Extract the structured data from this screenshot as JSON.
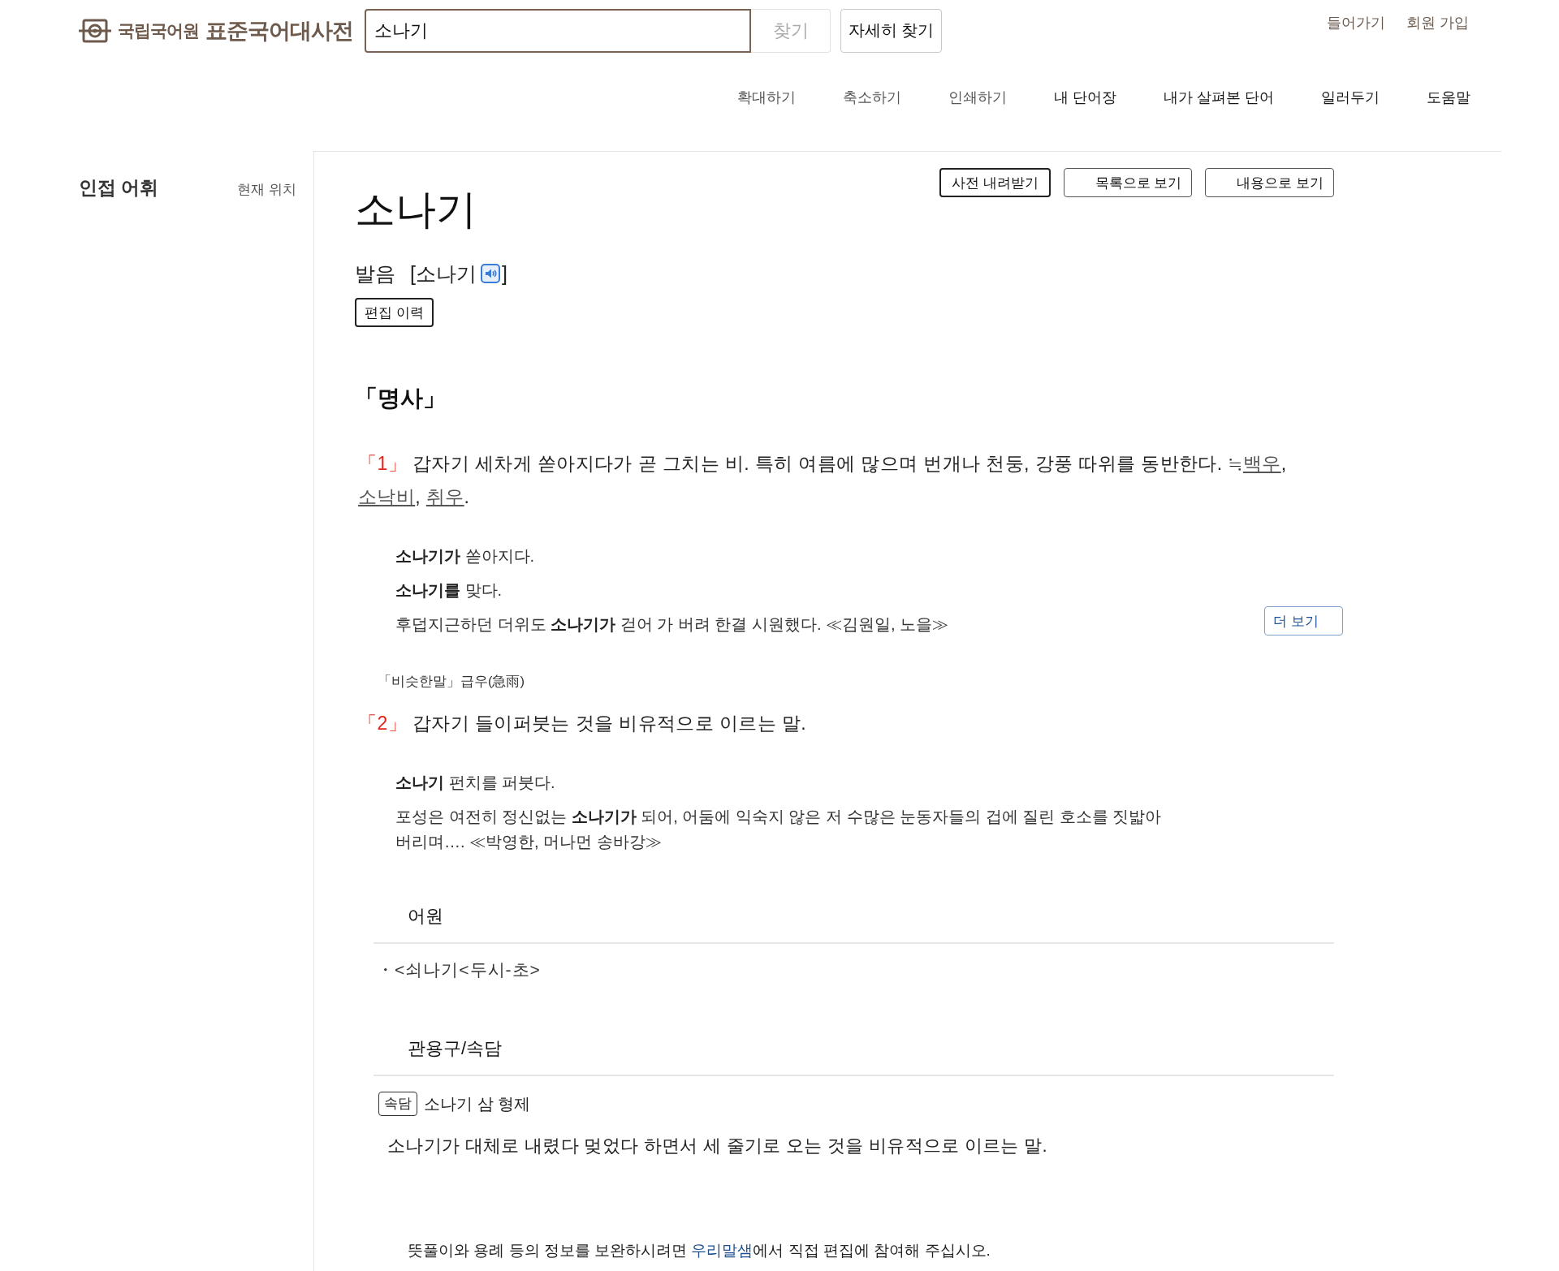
{
  "header": {
    "logo": {
      "organization": "국립국어원",
      "title": "표준국어대사전"
    },
    "search": {
      "value": "소나기",
      "button": "찾기"
    },
    "detail_search": "자세히 찾기",
    "account_links": [
      "들어가기",
      "회원 가입"
    ]
  },
  "toolbar": [
    {
      "label": "확대하기",
      "kind": "tool"
    },
    {
      "label": "축소하기",
      "kind": "tool"
    },
    {
      "label": "인쇄하기",
      "kind": "tool"
    },
    {
      "label": "내 단어장",
      "kind": "menu"
    },
    {
      "label": "내가 살펴본 단어",
      "kind": "menu"
    },
    {
      "label": "일러두기",
      "kind": "menu"
    },
    {
      "label": "도움말",
      "kind": "menu"
    }
  ],
  "sidebar": {
    "title": "인접 어휘",
    "current_position": "현재 위치"
  },
  "entry": {
    "actions": [
      {
        "label": "사전 내려받기",
        "kind": "plain"
      },
      {
        "label": "목록으로 보기",
        "kind": "view"
      },
      {
        "label": "내용으로 보기",
        "kind": "view"
      }
    ],
    "headword": "소나기",
    "pronunciation": {
      "label": "발음",
      "before_icon": "[소나기",
      "after_icon": "]"
    },
    "edit_history": "편집 이력",
    "part_of_speech": "「명사」",
    "senses": [
      {
        "number": "「1」",
        "definition": "갑자기 세차게 쏟아지다가 곧 그치는 비. 특히 여름에 많으며 번개나 천둥, 강풍 따위를 동반한다.",
        "related_mark": "≒",
        "related": [
          {
            "word": "백우",
            "after": ","
          },
          {
            "word": "소낙비",
            "after": ","
          },
          {
            "word": "취우",
            "after": "."
          }
        ],
        "examples": [
          "**소나기가** 쏟아지다.",
          "**소나기를** 맞다.",
          "후덥지근하던 더위도 **소나기가** 걷어 가 버려 한결 시원했다. ≪김원일, 노을≫"
        ],
        "more_button": "더 보기",
        "synonym": "「비슷한말」급우(急雨)"
      },
      {
        "number": "「2」",
        "definition": "갑자기 들이퍼붓는 것을 비유적으로 이르는 말.",
        "examples": [
          "**소나기** 펀치를 퍼붓다.",
          "포성은 여전히 정신없는 **소나기가** 되어, 어둠에 익숙지 않은 저 수많은 눈동자들의 겁에 질린 호소를 짓밟아 버리며…. ≪박영한, 머나먼 송바강≫"
        ]
      }
    ],
    "etymology": {
      "title": "어원",
      "items": [
        "・<쇠나기<두시-초>"
      ]
    },
    "idioms": {
      "title": "관용구/속담",
      "items": [
        {
          "tag": "속담",
          "phrase": "소나기 삼 형제",
          "meaning": "소나기가 대체로 내렸다 멎었다 하면서 세 줄기로 오는 것을 비유적으로 이르는 말."
        }
      ]
    },
    "footer": {
      "before": "뜻풀이와 용례 등의 정보를 보완하시려면 ",
      "link": "우리말샘",
      "after": "에서 직접 편집에 참여해 주십시오."
    }
  }
}
